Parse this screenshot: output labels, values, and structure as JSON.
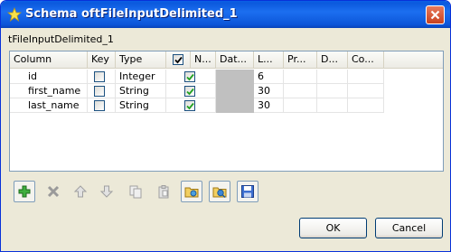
{
  "window": {
    "title": "Schema oftFileInputDelimited_1"
  },
  "subtitle": "tFileInputDelimited_1",
  "table": {
    "headers": [
      "Column",
      "Key",
      "Type",
      "",
      "N...",
      "Dat...",
      "L...",
      "Pr...",
      "D...",
      "Co..."
    ],
    "header_check_all": true,
    "rows": [
      {
        "column": "id",
        "key": false,
        "type": "Integer",
        "nullable": true,
        "length": "6"
      },
      {
        "column": "first_name",
        "key": false,
        "type": "String",
        "nullable": true,
        "length": "30"
      },
      {
        "column": "last_name",
        "key": false,
        "type": "String",
        "nullable": true,
        "length": "30"
      }
    ]
  },
  "toolbar": {
    "buttons": [
      {
        "name": "add-row",
        "icon": "plus-icon",
        "enabled": true
      },
      {
        "name": "delete-row",
        "icon": "x-icon",
        "enabled": false
      },
      {
        "name": "move-up",
        "icon": "arrow-up-icon",
        "enabled": false
      },
      {
        "name": "move-down",
        "icon": "arrow-down-icon",
        "enabled": false
      },
      {
        "name": "copy",
        "icon": "copy-icon",
        "enabled": false
      },
      {
        "name": "paste",
        "icon": "paste-icon",
        "enabled": false
      },
      {
        "name": "import-schema",
        "icon": "folder-import-icon",
        "enabled": true
      },
      {
        "name": "export-schema",
        "icon": "folder-export-icon",
        "enabled": true
      },
      {
        "name": "save",
        "icon": "save-icon",
        "enabled": true
      }
    ]
  },
  "buttons": {
    "ok": "OK",
    "cancel": "Cancel"
  },
  "colors": {
    "title_bar": "#0b59dd",
    "dialog_bg": "#ece9d8",
    "check_green": "#21a121",
    "grey_cell": "#c0c0c0"
  }
}
